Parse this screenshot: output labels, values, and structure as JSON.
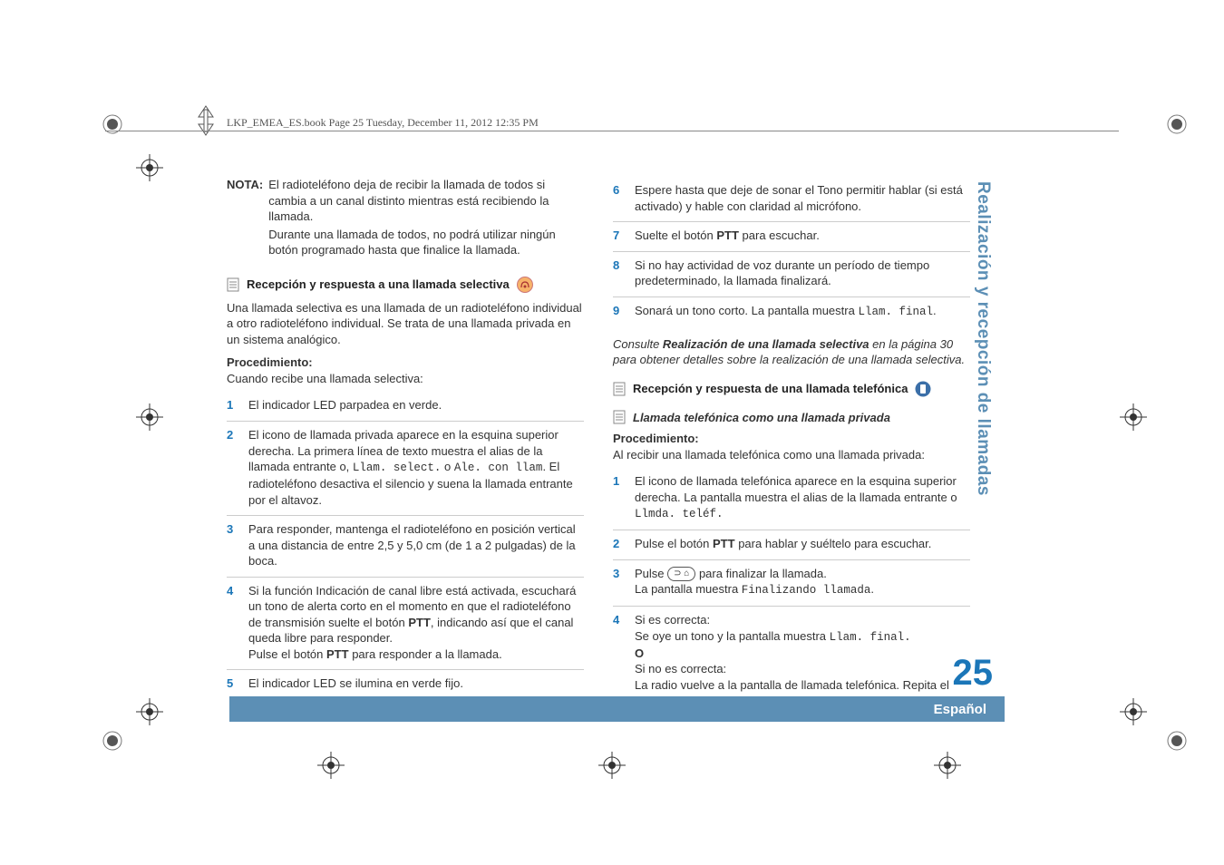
{
  "header": "LKP_EMEA_ES.book  Page 25  Tuesday, December 11, 2012  12:35 PM",
  "nota": {
    "label": "NOTA:",
    "p1": "El radioteléfono deja de recibir la llamada de todos si cambia a un canal distinto mientras está recibiendo la llamada.",
    "p2": "Durante una llamada de todos, no podrá utilizar ningún botón programado hasta que finalice la llamada."
  },
  "sec1": {
    "title": "Recepción y respuesta a una llamada selectiva",
    "intro": "Una llamada selectiva es una llamada de un radioteléfono individual a otro radioteléfono individual. Se trata de una llamada privada en un sistema analógico.",
    "proc_label": "Procedimiento:",
    "proc_sub": "Cuando recibe una llamada selectiva:",
    "items": {
      "i1": "El indicador LED parpadea en verde.",
      "i2a": "El icono de llamada privada aparece en la esquina superior derecha. La primera línea de texto muestra el alias de la llamada entrante o, ",
      "i2b": "Llam. select.",
      "i2c": " o ",
      "i2d": "Ale. con llam",
      "i2e": ". El radioteléfono desactiva el silencio y suena la llamada entrante por el altavoz.",
      "i3": "Para responder, mantenga el radioteléfono en posición vertical a una distancia de entre 2,5 y 5,0 cm (de 1 a 2 pulgadas) de la boca.",
      "i4a": "Si la función Indicación de canal libre está activada, escuchará un tono de alerta corto en el momento en que el radioteléfono de transmisión suelte el botón ",
      "i4b": "PTT",
      "i4c": ", indicando así que el canal queda libre para responder.",
      "i4d": "Pulse el botón ",
      "i4e": "PTT",
      "i4f": " para responder a la llamada.",
      "i5": "El indicador LED se ilumina en verde fijo."
    }
  },
  "col2": {
    "items": {
      "i6": "Espere hasta que deje de sonar el Tono permitir hablar (si está activado) y hable con claridad al micrófono.",
      "i7a": "Suelte el botón ",
      "i7b": "PTT",
      "i7c": " para escuchar.",
      "i8": "Si no hay actividad de voz durante un período de tiempo predeterminado, la llamada finalizará.",
      "i9a": "Sonará un tono corto. La pantalla muestra ",
      "i9b": "Llam. final"
    },
    "ref1": "Consulte ",
    "ref2": "Realización de una llamada selectiva",
    "ref3": " en la página 30 para obtener detalles sobre la realización de una llamada selectiva.",
    "sec2_title": "Recepción y respuesta de una llamada telefónica",
    "sub_title": "Llamada telefónica como una llamada privada",
    "proc_label": "Procedimiento:",
    "proc_sub": "Al recibir una llamada telefónica como una llamada privada:",
    "items2": {
      "i1a": "El icono de llamada telefónica aparece en la esquina superior derecha. La pantalla muestra el alias de la llamada entrante o ",
      "i1b": "Llmda. teléf.",
      "i2a": "Pulse el botón ",
      "i2b": "PTT",
      "i2c": " para hablar y suéltelo para escuchar.",
      "i3a": "Pulse ",
      "i3b": " para finalizar la llamada.",
      "i3c": "La pantalla muestra ",
      "i3d": "Finalizando llamada",
      "i4a": "Si es correcta:",
      "i4b": "Se oye un tono y la pantalla muestra ",
      "i4c": "Llam. final.",
      "i4d": "O",
      "i4e": "Si no es correcta:",
      "i4f": "La radio vuelve a la pantalla de llamada telefónica. Repita el"
    }
  },
  "side_tab": "Realización y recepción de llamadas",
  "page_num": "25",
  "footer_lang": "Español",
  "btn_glyph": "⊃ ⌂"
}
